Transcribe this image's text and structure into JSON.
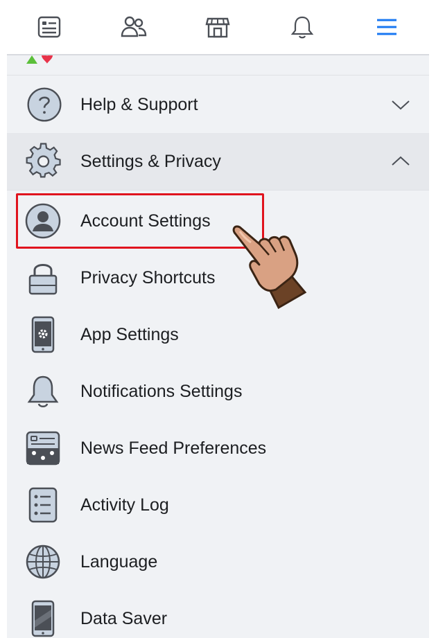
{
  "nav": {
    "tabs": [
      {
        "icon": "news-feed-icon"
      },
      {
        "icon": "friends-icon"
      },
      {
        "icon": "marketplace-icon"
      },
      {
        "icon": "notifications-bell-icon"
      },
      {
        "icon": "menu-icon",
        "active": true
      }
    ],
    "active_color": "#1877f2"
  },
  "help_support": {
    "label": "Help & Support",
    "icon": "help-circle-icon",
    "expanded": false
  },
  "settings_privacy": {
    "label": "Settings & Privacy",
    "icon": "gear-icon",
    "expanded": true,
    "items": [
      {
        "label": "Account Settings",
        "icon": "account-avatar-icon",
        "highlighted": true
      },
      {
        "label": "Privacy Shortcuts",
        "icon": "padlock-icon"
      },
      {
        "label": "App Settings",
        "icon": "phone-settings-icon"
      },
      {
        "label": "Notifications Settings",
        "icon": "bell-icon"
      },
      {
        "label": "News Feed Preferences",
        "icon": "news-feed-preferences-icon"
      },
      {
        "label": "Activity Log",
        "icon": "activity-log-icon"
      },
      {
        "label": "Language",
        "icon": "globe-icon"
      },
      {
        "label": "Data Saver",
        "icon": "phone-icon"
      }
    ]
  },
  "annotation": {
    "highlight_color": "#e0141e",
    "pointer": "pointing-hand-icon"
  }
}
